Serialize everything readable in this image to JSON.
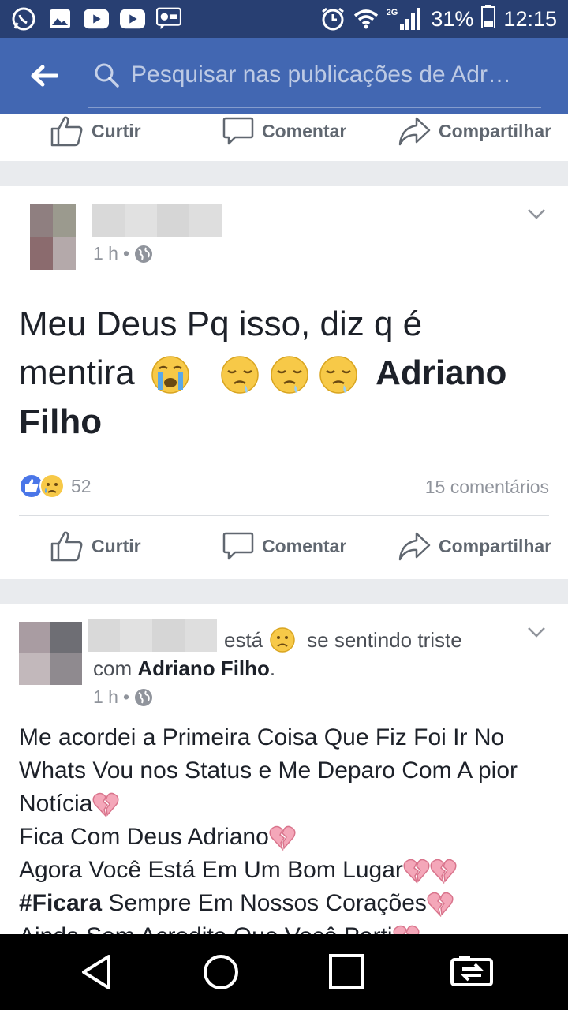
{
  "status_bar": {
    "network": "2G",
    "battery": "31%",
    "time": "12:15",
    "icons": [
      "whatsapp-icon",
      "gallery-icon",
      "youtube-icon",
      "youtube-icon",
      "lg-message-icon",
      "alarm-icon",
      "wifi-icon",
      "signal-icon",
      "battery-icon"
    ]
  },
  "app_bar": {
    "back_icon": "arrow-left-icon",
    "search_placeholder": "Pesquisar nas publicações de Adr…"
  },
  "actions": {
    "like": "Curtir",
    "comment": "Comentar",
    "share": "Compartilhar"
  },
  "post1": {
    "time": "1 h",
    "privacy_icon": "globe-icon",
    "text_line1": "Meu Deus Pq isso, diz q é",
    "text_line2_prefix": "mentira",
    "tagged_name_part1": "Adriano",
    "tagged_name_part2": "Filho",
    "reaction_count": "52",
    "comments": "15 comentários"
  },
  "post2": {
    "feeling_prefix": "está",
    "feeling": "se sentindo triste",
    "with_prefix": "com",
    "with_name": "Adriano Filho",
    "with_suffix": ".",
    "time": "1 h",
    "line1": "Me acordei a Primeira Coisa Que Fiz Foi Ir No",
    "line2": "Whats Vou nos Status e Me Deparo Com A pior",
    "line3": "Notícia",
    "line4": "Fica  Com Deus Adriano",
    "line5": "Agora Você Está Em Um Bom Lugar",
    "line6_tag": "#Ficara",
    "line6_rest": " Sempre Em Nossos Corações",
    "line7_partial": "Ainda Sem Acredita Que Você Parti"
  },
  "nav_bar": {
    "icons": [
      "back-triangle-icon",
      "home-circle-icon",
      "recents-square-icon",
      "switch-apps-icon"
    ]
  },
  "colors": {
    "status_bar": "#283f72",
    "app_bar": "#4267b2",
    "like_blue": "#4a76e8"
  }
}
